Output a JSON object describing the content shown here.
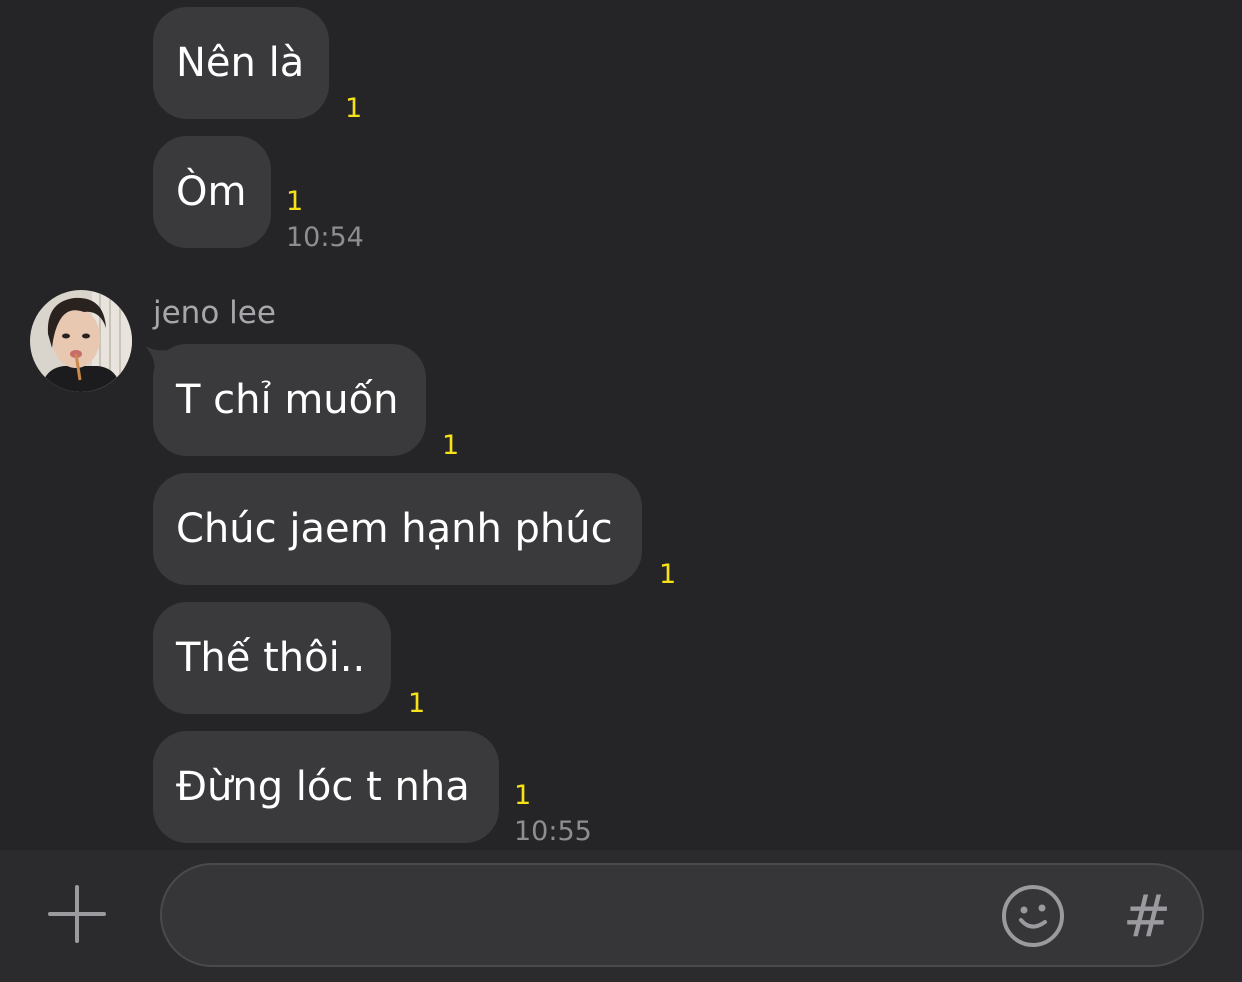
{
  "messages": [
    {
      "text": "Nên là",
      "unread": "1",
      "time": ""
    },
    {
      "text": "Òm",
      "unread": "1",
      "time": "10:54"
    },
    {
      "text": "T chỉ muốn",
      "unread": "1",
      "time": ""
    },
    {
      "text": "Chúc jaem hạnh phúc",
      "unread": "1",
      "time": ""
    },
    {
      "text": "Thế thôi..",
      "unread": "1",
      "time": ""
    },
    {
      "text": "Đừng lóc t nha",
      "unread": "1",
      "time": "10:55"
    }
  ],
  "sender": {
    "name": "jeno lee",
    "avatar_icon": "profile-photo"
  },
  "input_bar": {
    "value": "",
    "placeholder": "",
    "attach_icon": "plus-icon",
    "emoji_icon": "smiley-icon",
    "hashtag_label": "#"
  },
  "colors": {
    "background": "#252528",
    "bubble": "#3a3a3c",
    "unread": "#f7e21a",
    "timestamp": "#8e8e92"
  }
}
